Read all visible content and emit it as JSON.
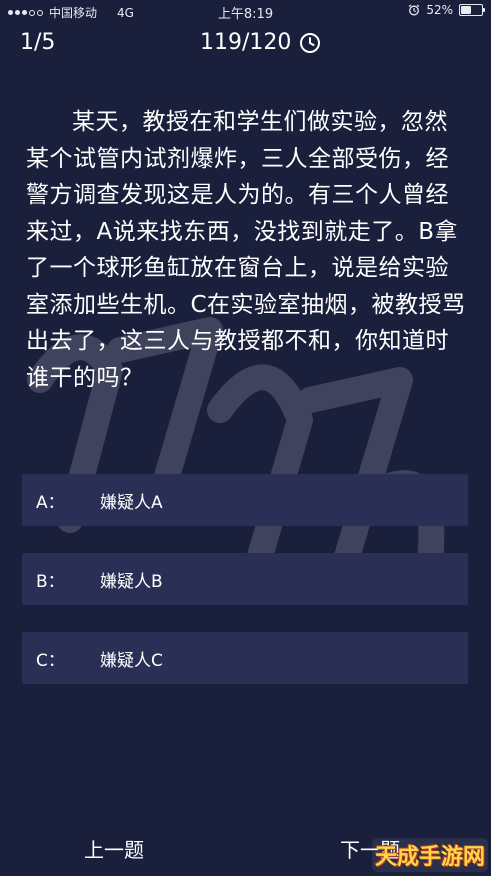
{
  "status_bar": {
    "carrier": "中国移动",
    "network": "4G",
    "time": "上午8:19",
    "battery_percent": "52%",
    "battery_level": 0.52
  },
  "header": {
    "progress": "1/5",
    "timer": "119/120",
    "timer_icon": "clock-icon"
  },
  "question": {
    "text": "某天，教授在和学生们做实验，忽然某个试管内试剂爆炸，三人全部受伤，经警方调查发现这是人为的。有三个人曾经来过，A说来找东西，没找到就走了。B拿了一个球形鱼缸放在窗台上，说是给实验室添加些生机。C在实验室抽烟，被教授骂出去了，这三人与教授都不和，你知道时谁干的吗？"
  },
  "options": [
    {
      "key": "A：",
      "text": "嫌疑人A"
    },
    {
      "key": "B：",
      "text": "嫌疑人B"
    },
    {
      "key": "C：",
      "text": "嫌疑人C"
    }
  ],
  "footer": {
    "prev_label": "上一题",
    "next_label": "下一题"
  },
  "watermark": {
    "stamp": "天成手游网"
  },
  "colors": {
    "background": "#1a1f3b",
    "option_bg": "#2a3055",
    "text": "#ffffff"
  }
}
